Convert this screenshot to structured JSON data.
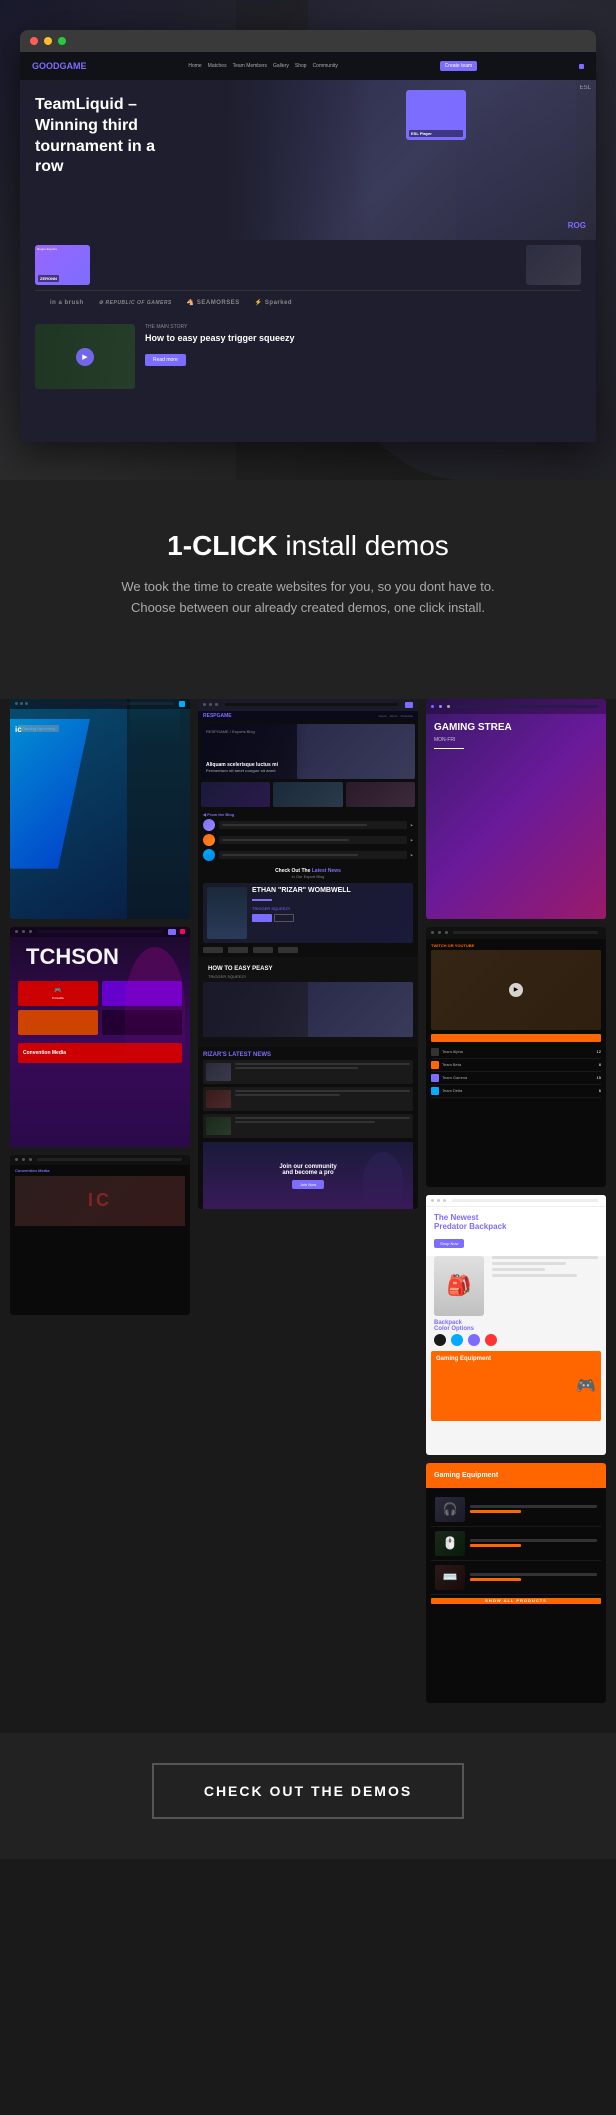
{
  "hero": {
    "browser": {
      "nav": {
        "logo": "GOOD",
        "logo_accent": "GAME",
        "links": [
          "Home",
          "Matches",
          "Team Members",
          "Gallery",
          "Shop",
          "Community"
        ],
        "cta": "Create team"
      },
      "headline": "TeamLiquid – Winning third tournament in a row",
      "player_cards": [
        {
          "name": "ZERONN",
          "subtitle": "Rogue Esports"
        },
        {
          "name": "ESL Player",
          "subtitle": ""
        }
      ],
      "sponsors": [
        "in a brush",
        "REPUBLIC OF GAMERS",
        "SEAMORSES",
        "Sparked"
      ],
      "video": {
        "label": "THE MAIN STORY",
        "title": "How to easy peasy trigger squeezy",
        "cta": "Read more"
      }
    }
  },
  "one_click_section": {
    "title_bold": "1-CLICK",
    "title_rest": " install demos",
    "subtitle": "We took the time to create websites for you, so you dont have to.\nChoose between our already created demos, one click install."
  },
  "demos": {
    "left": [
      {
        "id": "demo-left-1",
        "type": "gaming-cyan",
        "tag": "Gaming Upcoming",
        "title": "ic"
      },
      {
        "id": "demo-left-2",
        "type": "purple-character",
        "big_text": "TCHSON"
      },
      {
        "id": "demo-left-3",
        "type": "convention",
        "label": "Convention Media",
        "hero_text": "IC"
      }
    ],
    "middle": {
      "id": "demo-middle",
      "player_name": "ETHAN \"RIZAR\"\nWOMBWELL",
      "player_tag": "TRIGGER SQUEEZY",
      "section_title": "HOW TO EASY PEASY\nTRIGGER SQUEEZY",
      "news_title": "RIZAR'S LATEST NEWS",
      "cta_text": "Join our community\nand become a pro"
    },
    "right_top": {
      "id": "demo-right-1",
      "title": "GAMING STREA",
      "sub": "MON-FRI",
      "label": "TWITCH OR YOUTUBE"
    },
    "right_middle": {
      "id": "demo-right-2",
      "title": "The Newest\nPredator Backpack",
      "section_title": "Backpack\nColor Options",
      "footer_title": "Gaming Equipment"
    }
  },
  "cta": {
    "button_label": "CHECK OUT THE DEMOS"
  }
}
